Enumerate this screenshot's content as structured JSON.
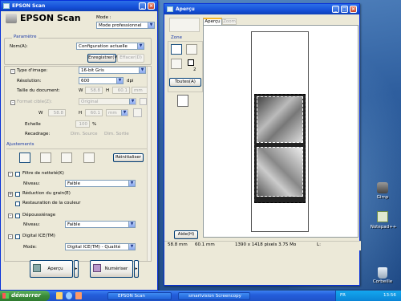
{
  "desktop": {
    "icons": [
      {
        "label": "Gimp"
      },
      {
        "label": "Notepad++"
      },
      {
        "label": "Corbeille"
      }
    ]
  },
  "epson": {
    "title": "EPSON Scan",
    "brand": "EPSON Scan",
    "mode_label": "Mode :",
    "mode_value": "Mode professionnel",
    "parametre_label": "Paramètre",
    "nom_label": "Nom(A):",
    "nom_value": "Configuration actuelle",
    "save_btn": "Enregistrer(V)",
    "delete_btn": "Effacer(D)",
    "type_label": "Type d'image:",
    "type_value": "16-bit Gris",
    "resolution_label": "Résolution:",
    "resolution_value": "600",
    "resolution_unit": "dpi",
    "taille_label": "Taille du document:",
    "taille_w_label": "W",
    "taille_w": "58.8",
    "taille_h_label": "H",
    "taille_h": "60.1",
    "taille_unit": "mm",
    "format_label": "Format cible(Z):",
    "format_value": "Original",
    "w_label": "W",
    "w_value": "58.8",
    "h_label": "H",
    "h_value": "60.1",
    "unit": "mm",
    "echelle_label": "Echelle",
    "echelle_value": "100",
    "echelle_unit": "%",
    "recadrage_label": "Recadrage:",
    "source_label": "Dim. Source",
    "sortie_label": "Dim. Sortie",
    "ajustements_label": "Ajustements",
    "reset_btn": "Réinitialiser",
    "nettete_label": "Filtre de netteté(K)",
    "niveau1_label": "Niveau:",
    "niveau1_value": "Faible",
    "grain_label": "Réduction du grain(E)",
    "couleur_label": "Restauration de la couleur",
    "depoussierage_label": "Dépoussiérage",
    "niveau2_label": "Niveau:",
    "niveau2_value": "Faible",
    "ice_label": "Digital ICE(TM)",
    "mode2_label": "Mode:",
    "mode2_value": "Digital ICE(TM) - Qualité",
    "apercu_btn": "Aperçu",
    "numeriser_btn": "Numériser"
  },
  "preview": {
    "title": "Aperçu",
    "tab_apercu": "Aperçu",
    "tab_zoom": "Zoom",
    "zone_label": "Zone",
    "zone_count": "2",
    "toutes_btn": "Toutes(A)",
    "help_btn": "Aide(H)",
    "status_w": "58.8 mm",
    "status_h": "60.1 mm",
    "status_info": "1390 x 1418 pixels 3.75 Mo",
    "status_end": "L:"
  },
  "taskbar": {
    "start": "démarrer",
    "tasks": [
      "EPSON Scan",
      "smartvision Screencopy"
    ],
    "lang": "FR",
    "time": "13:56"
  }
}
